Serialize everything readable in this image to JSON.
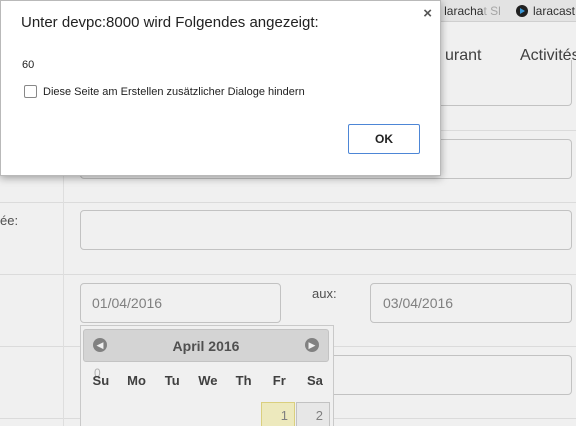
{
  "dialog": {
    "title": "Unter devpc:8000 wird Folgendes angezeigt:",
    "message": "60",
    "checkbox_label": "Diese Seite am Erstellen zusätzlicher Dialoge hindern",
    "checkbox_checked": false,
    "ok_label": "OK",
    "close_glyph": "×"
  },
  "bookmarks": [
    {
      "text": "laracha",
      "faded": "t Sl",
      "separator": "|"
    },
    {
      "text": "laracast"
    }
  ],
  "nav": {
    "item_partial": "urant",
    "item_activites": "Activités"
  },
  "labels": {
    "partial_ee": "ée:",
    "aux": "aux:"
  },
  "dates": {
    "start": "01/04/2016",
    "end": "03/04/2016"
  },
  "datepicker": {
    "title": "April 2016",
    "prev_glyph": "◀",
    "next_glyph": "▶",
    "weekdays": [
      "Su",
      "Mo",
      "Tu",
      "We",
      "Th",
      "Fr",
      "Sa"
    ],
    "ghost_digit": "0",
    "visible_days": [
      "1",
      "2"
    ],
    "highlight_color": "#fcf8c9"
  },
  "colors": {
    "ok_border": "#4d86d6",
    "dialog_border": "#b9b9b9"
  }
}
